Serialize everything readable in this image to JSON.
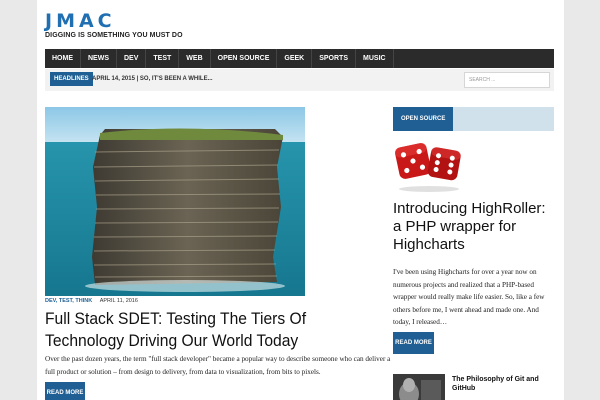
{
  "site": {
    "logo": "JMAC",
    "tagline": "DIGGING IS SOMETHING YOU MUST DO"
  },
  "nav": {
    "items": [
      "HOME",
      "NEWS",
      "DEV",
      "TEST",
      "WEB",
      "OPEN SOURCE",
      "GEEK",
      "SPORTS",
      "MUSIC"
    ]
  },
  "headlines": {
    "badge": "HEADLINES",
    "ticker": "APRIL 14, 2015 | SO, IT'S BEEN A WHILE...",
    "search_placeholder": "SEARCH ..."
  },
  "main_post": {
    "categories": "DEV, TEST, THINK",
    "date": "APRIL 11, 2016",
    "title": "Full Stack SDET: Testing The Tiers Of Technology Driving Our World Today",
    "excerpt": "Over the past dozen years, the term \"full stack developer\" became a popular way to describe someone who can deliver a full product or solution – from design to delivery, from data to visualization, from bits to pixels.",
    "read_more": "READ MORE"
  },
  "sidebar": {
    "badge": "OPEN SOURCE",
    "featured_title": "Introducing HighRoller: a PHP wrapper for Highcharts",
    "featured_excerpt": "I've been using Highcharts for over a year now on numerous projects and realized that a PHP-based wrapper would really make life easier. So, like a few others before me, I went ahead and made one. And today, I released…",
    "read_more": "READ MORE",
    "small_post_title": "The Philosophy of Git and GitHub"
  },
  "colors": {
    "brand": "#1f6fb2",
    "accent": "#1f5f94",
    "nav_bg": "#2b2b2b"
  }
}
